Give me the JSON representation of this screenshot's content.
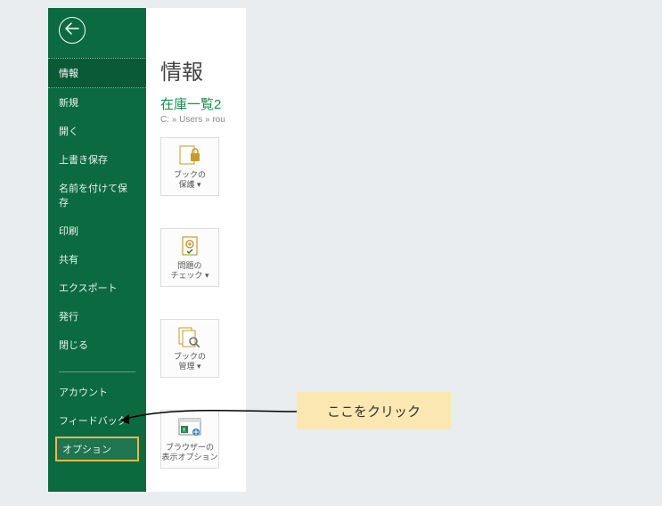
{
  "sidebar": {
    "items": [
      {
        "label": "情報"
      },
      {
        "label": "新規"
      },
      {
        "label": "開く"
      },
      {
        "label": "上書き保存"
      },
      {
        "label": "名前を付けて保存"
      },
      {
        "label": "印刷"
      },
      {
        "label": "共有"
      },
      {
        "label": "エクスポート"
      },
      {
        "label": "発行"
      },
      {
        "label": "閉じる"
      }
    ],
    "bottom": [
      {
        "label": "アカウント"
      },
      {
        "label": "フィードバック"
      },
      {
        "label": "オプション"
      }
    ]
  },
  "content": {
    "title": "情報",
    "doc_name": "在庫一覧2",
    "doc_path": "C: » Users » rou",
    "tiles": [
      {
        "line1": "ブックの",
        "line2": "保護 ▾"
      },
      {
        "line1": "問題の",
        "line2": "チェック ▾"
      },
      {
        "line1": "ブックの",
        "line2": "管理 ▾"
      },
      {
        "line1": "ブラウザーの",
        "line2": "表示オプション"
      }
    ]
  },
  "callout": {
    "text": "ここをクリック"
  }
}
